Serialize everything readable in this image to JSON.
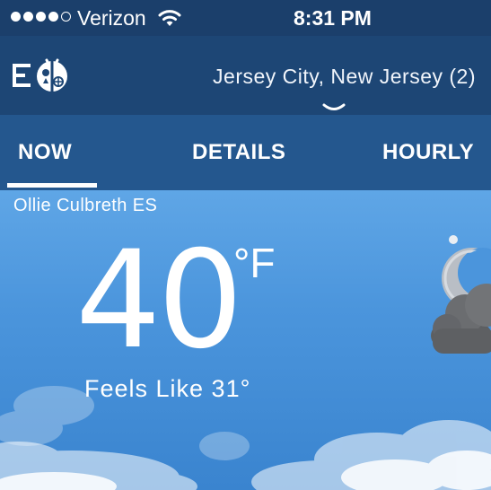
{
  "status_bar": {
    "signal_filled": 4,
    "signal_total": 5,
    "carrier": "Verizon",
    "wifi_icon": "wifi-icon",
    "time": "8:31 PM"
  },
  "header": {
    "logo_icon": "weatherbug-logo-icon",
    "location": "Jersey City, New Jersey (2)",
    "chevron_icon": "chevron-down-icon"
  },
  "tabs": [
    {
      "label": "NOW",
      "active": true
    },
    {
      "label": "DETAILS",
      "active": false
    },
    {
      "label": "HOURLY",
      "active": false
    }
  ],
  "current": {
    "station": "Ollie Culbreth ES",
    "temperature": "40",
    "unit": "°F",
    "feels_like": "Feels Like 31°",
    "condition_icon": "partly-cloudy-night-icon"
  },
  "colors": {
    "status_bar_bg": "#1b3f6b",
    "header_bg": "#1d4675",
    "tabs_bg": "#24578e",
    "sky_bg": "#4b95dc"
  }
}
